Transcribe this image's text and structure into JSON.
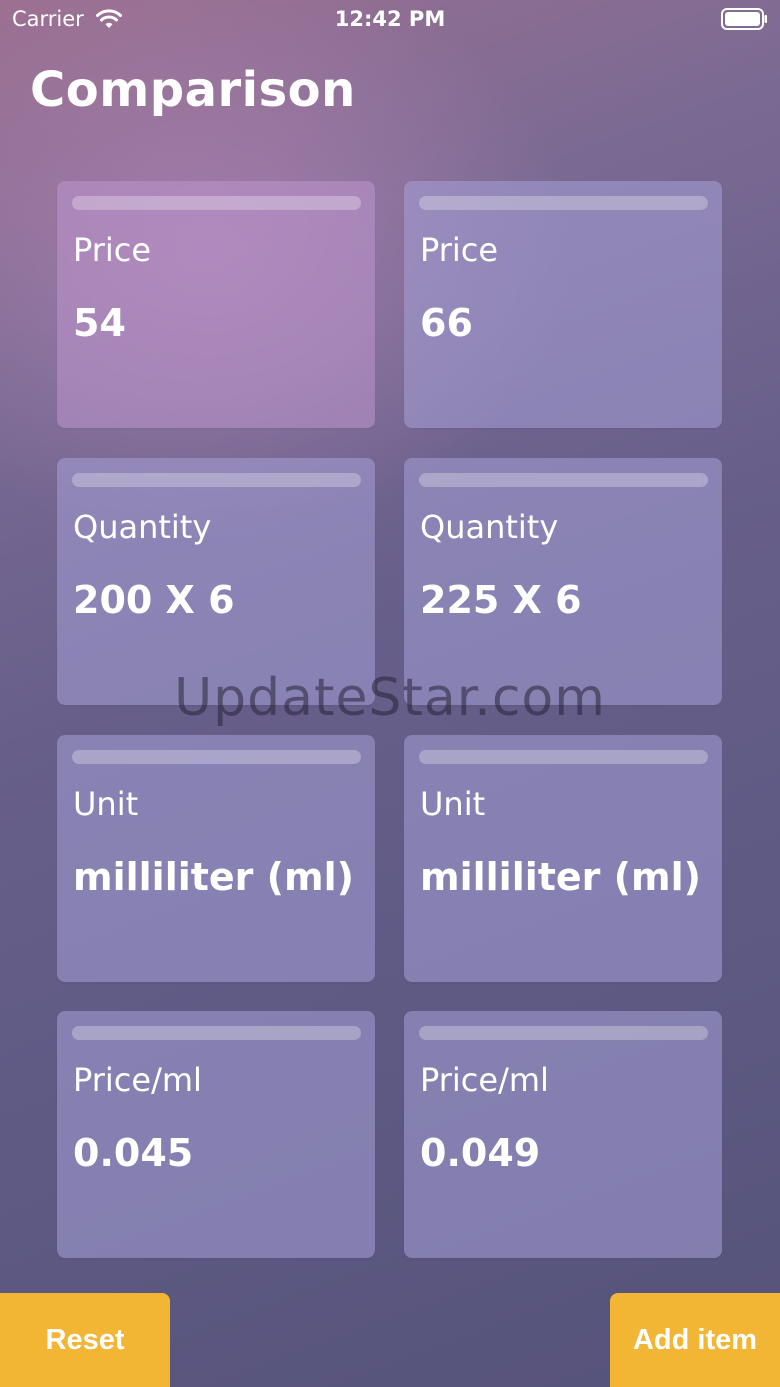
{
  "status_bar": {
    "carrier": "Carrier",
    "time": "12:42 PM",
    "wifi_icon": "wifi-icon",
    "battery_icon": "battery-icon"
  },
  "page": {
    "title": "Comparison"
  },
  "cards": [
    {
      "label": "Price",
      "value": "54"
    },
    {
      "label": "Price",
      "value": "66"
    },
    {
      "label": "Quantity",
      "value": "200 X 6"
    },
    {
      "label": "Quantity",
      "value": "225 X 6"
    },
    {
      "label": "Unit",
      "value": "milliliter (ml)"
    },
    {
      "label": "Unit",
      "value": "milliliter (ml)"
    },
    {
      "label": "Price/ml",
      "value": "0.045"
    },
    {
      "label": "Price/ml",
      "value": "0.049"
    }
  ],
  "watermark": "UpdateStar.com",
  "buttons": {
    "reset_label": "Reset",
    "add_item_label": "Add item"
  },
  "colors": {
    "accent": "#f2b534",
    "text": "#ffffff"
  }
}
